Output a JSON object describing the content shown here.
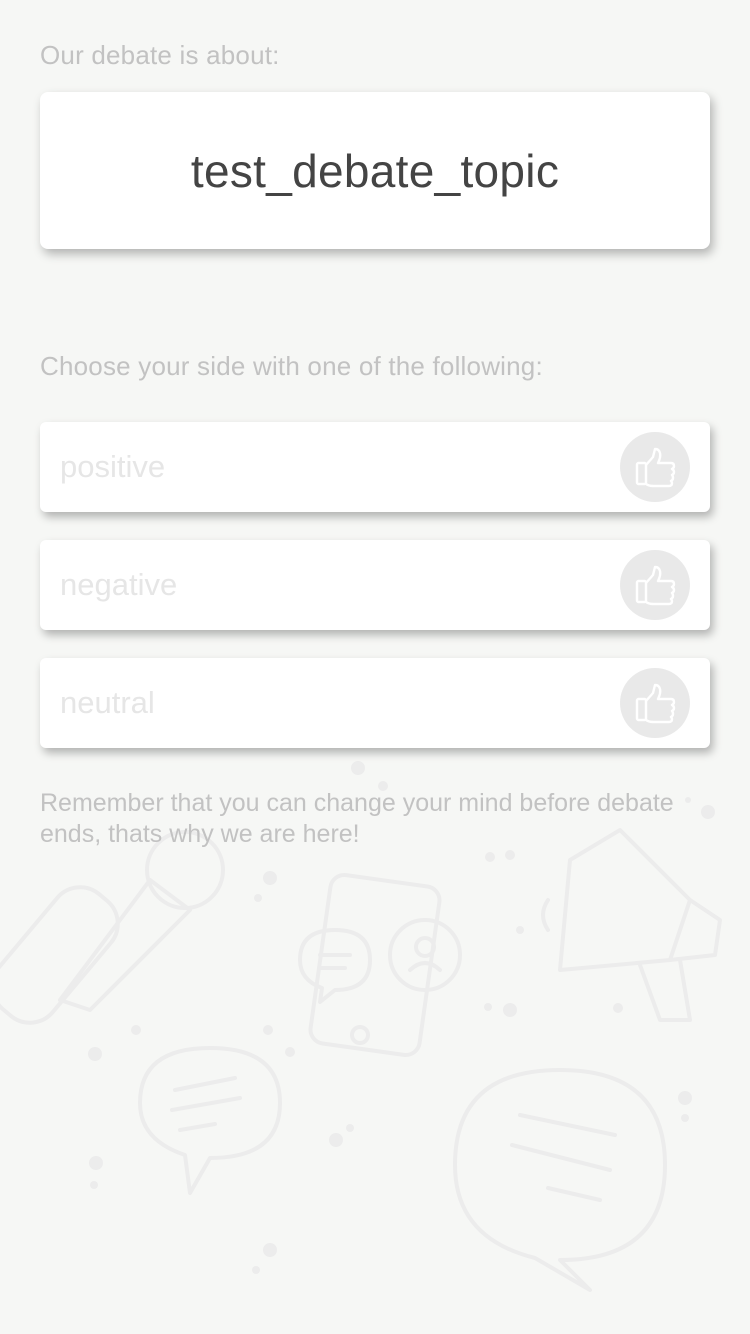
{
  "topic_section": {
    "label": "Our debate is about:",
    "topic": "test_debate_topic"
  },
  "sides_section": {
    "label": "Choose your side with one of the following:",
    "options": [
      {
        "label": "positive",
        "icon": "thumbs-up-icon"
      },
      {
        "label": "negative",
        "icon": "thumbs-up-icon"
      },
      {
        "label": "neutral",
        "icon": "thumbs-up-icon"
      }
    ]
  },
  "note": "Remember that you can change your mind before debate ends, thats why we are here!",
  "colors": {
    "background": "#f6f7f5",
    "card": "#ffffff",
    "muted_text": "#c2c2c2",
    "topic_text": "#444444",
    "option_text": "#e6e6e6",
    "thumb_circle": "#e9e9e9"
  }
}
